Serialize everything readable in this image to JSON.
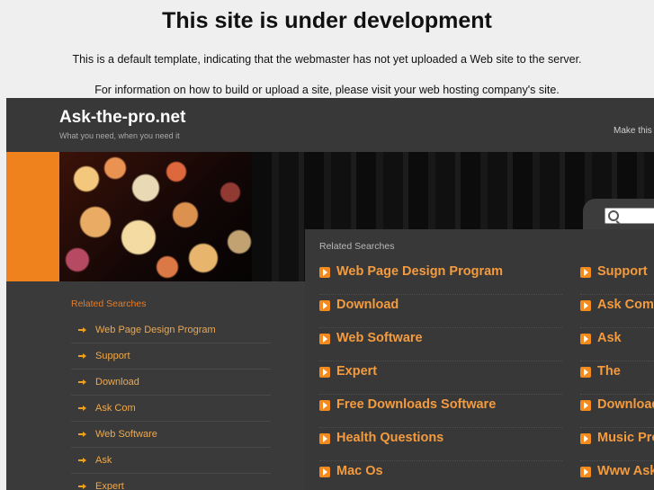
{
  "notice": {
    "title": "This site is under development",
    "line1": "This is a default template, indicating that the webmaster has not yet uploaded a Web site to the server.",
    "line2": "For information on how to build or upload a site, please visit your web hosting company's site."
  },
  "site": {
    "title": "Ask-the-pro.net",
    "tagline": "What you need, when you need it",
    "make_this": "Make this"
  },
  "left": {
    "heading": "Related Searches",
    "items": [
      {
        "label": "Web Page Design Program"
      },
      {
        "label": "Support"
      },
      {
        "label": "Download"
      },
      {
        "label": "Ask Com"
      },
      {
        "label": "Web Software"
      },
      {
        "label": "Ask"
      },
      {
        "label": "Expert"
      }
    ]
  },
  "main": {
    "heading": "Related Searches",
    "col1": [
      {
        "label": "Web Page Design Program"
      },
      {
        "label": "Download"
      },
      {
        "label": "Web Software"
      },
      {
        "label": "Expert"
      },
      {
        "label": "Free Downloads Software"
      },
      {
        "label": "Health Questions"
      },
      {
        "label": "Mac Os"
      }
    ],
    "col2": [
      {
        "label": "Support"
      },
      {
        "label": "Ask Com"
      },
      {
        "label": "Ask"
      },
      {
        "label": "The"
      },
      {
        "label": "Downloads"
      },
      {
        "label": "Music Pro"
      },
      {
        "label": "Www Ask"
      }
    ]
  },
  "colors": {
    "accent": "#f0821e",
    "link": "#f39b3e",
    "background": "#3a3a3a"
  }
}
